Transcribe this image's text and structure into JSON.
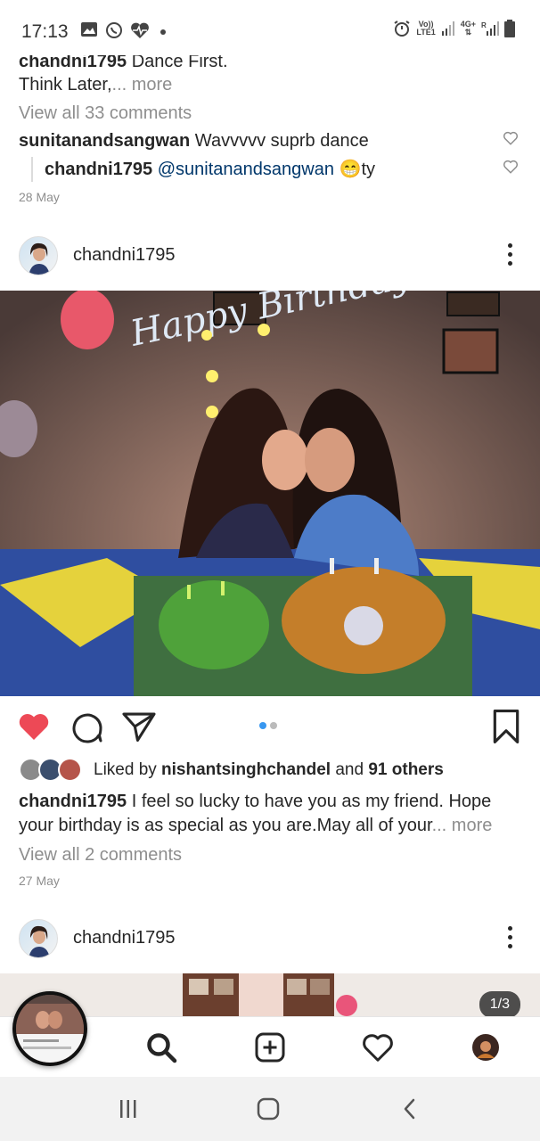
{
  "status_bar": {
    "time": "17:13",
    "network_top": "Vo))",
    "network_bottom": "LTE1",
    "network2_top": "4G+",
    "network2_bottom": "R"
  },
  "previous_post": {
    "caption_user": "chandni1795",
    "caption_text": " Dance First.",
    "caption_line2": "Think Later,",
    "caption_more": "... more",
    "view_comments": "View all 33 comments",
    "comment_user": "sunitanandsangwan",
    "comment_text": " Wavvvvv suprb dance",
    "reply_user": "chandni1795",
    "reply_mention": "@sunitanandsangwan",
    "reply_emoji": "😁",
    "reply_text": "ty",
    "date": "28 May"
  },
  "post": {
    "username": "chandni1795",
    "photo_text": "Happy Birthday",
    "likers_prefix": "Liked by ",
    "likers_user": "nishantsinghchandel",
    "likers_and": " and ",
    "likers_others": "91 others",
    "caption_user": "chandni1795",
    "caption_line1": " I feel so lucky to have you as my friend. Hope",
    "caption_line2": "your birthday is as special as you are.May all of your",
    "caption_more": "... more",
    "view_comments": "View all 2 comments",
    "date": "27 May",
    "liked": true
  },
  "next_post": {
    "username": "chandni1795",
    "carousel_count": "1/3"
  },
  "bottom_nav": {
    "items": [
      "home",
      "search",
      "new-post",
      "activity",
      "profile"
    ]
  },
  "colors": {
    "like_red": "#ed4956",
    "active_dot": "#3897f0",
    "mention": "#00376b"
  }
}
